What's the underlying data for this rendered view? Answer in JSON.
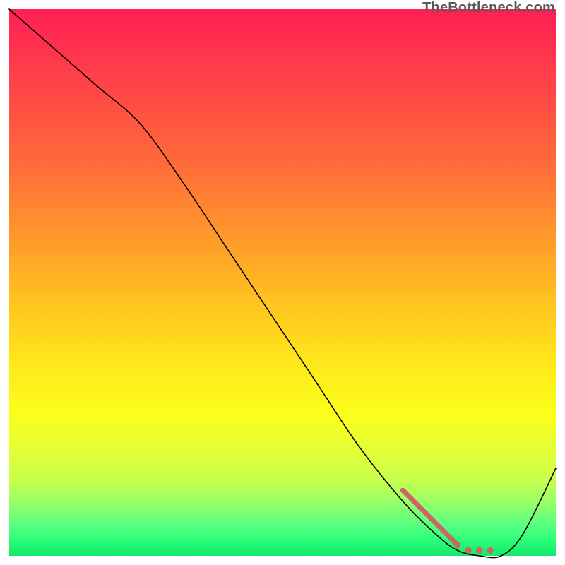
{
  "watermark": "TheBottleneck.com",
  "chart_data": {
    "type": "line",
    "title": "",
    "xlabel": "",
    "ylabel": "",
    "xlim": [
      0,
      100
    ],
    "ylim": [
      0,
      100
    ],
    "grid": false,
    "series": [
      {
        "name": "curve",
        "x": [
          0,
          8,
          16,
          24,
          32,
          40,
          48,
          56,
          64,
          72,
          78,
          82,
          86,
          90,
          94,
          100
        ],
        "y": [
          100,
          93,
          86,
          79,
          68,
          56,
          44,
          32,
          20,
          10,
          4,
          1,
          0,
          0,
          4,
          16
        ]
      }
    ],
    "highlight": {
      "name": "highlight-segment",
      "x": [
        72,
        76,
        80,
        82,
        84,
        86,
        88
      ],
      "y": [
        12,
        8,
        4,
        2,
        1,
        1,
        1
      ]
    },
    "background_gradient": {
      "top": "#ff1f55",
      "bottom": "#14e86b"
    }
  }
}
